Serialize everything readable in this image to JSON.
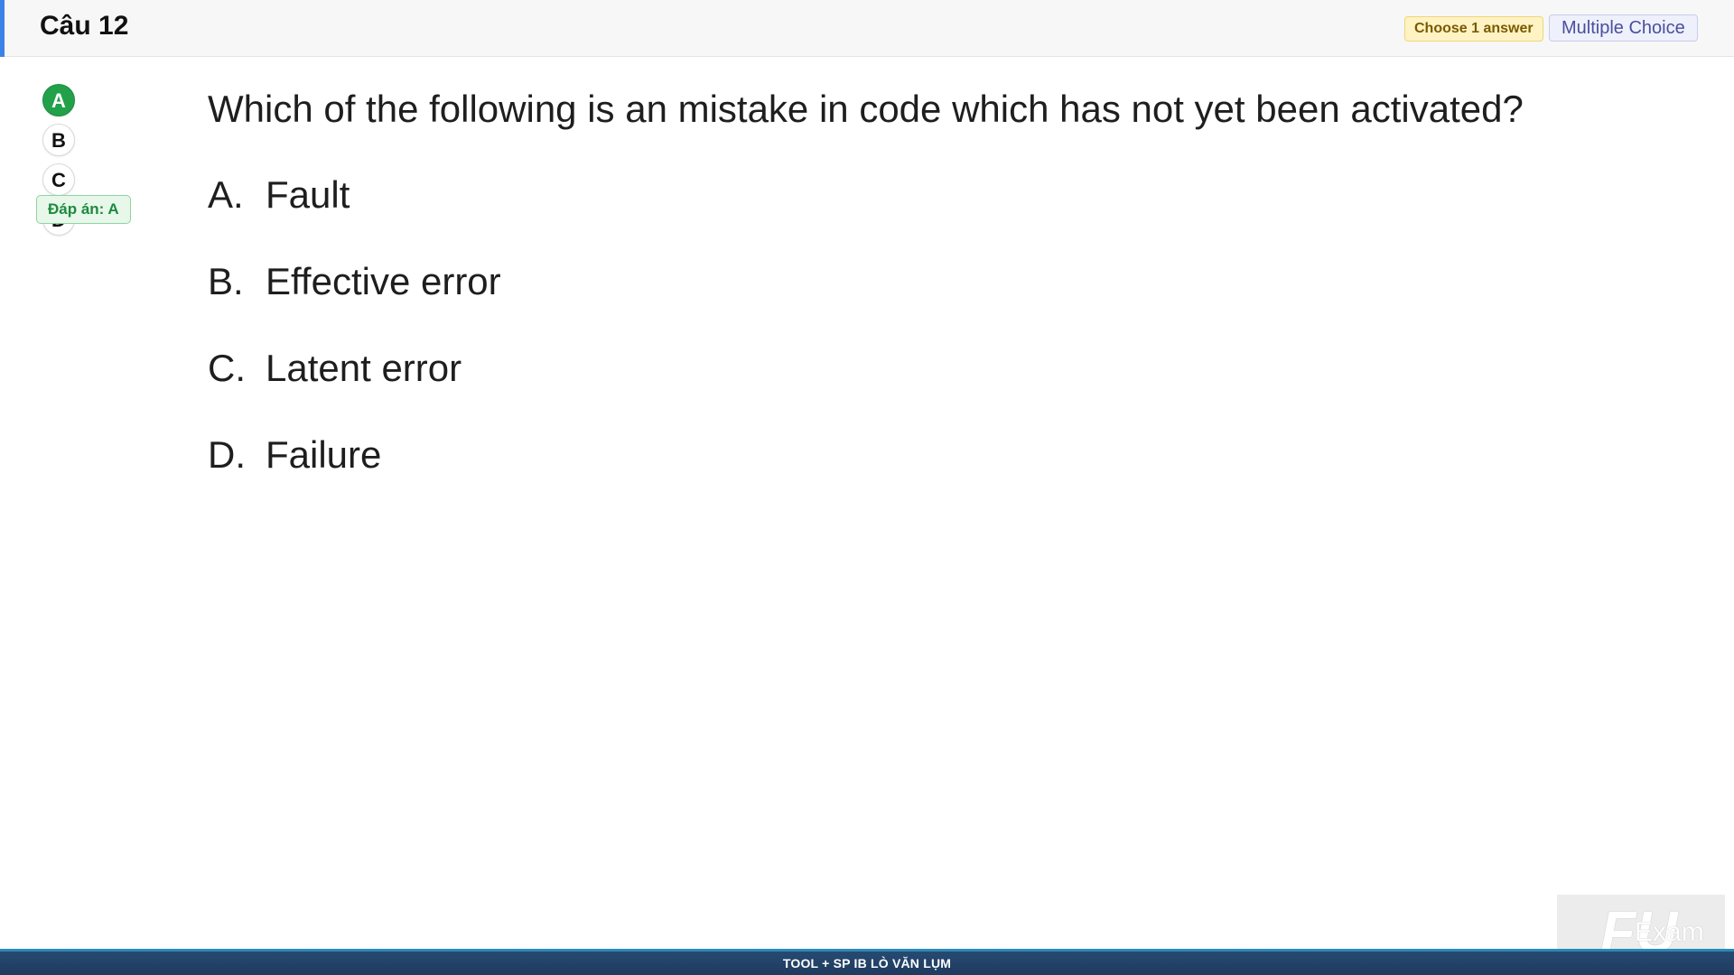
{
  "header": {
    "title": "Câu 12",
    "choose_badge": "Choose 1 answer",
    "type_badge": "Multiple Choice",
    "accent_color": "#3b82e6"
  },
  "option_selector": {
    "options": [
      "A",
      "B",
      "C",
      "D"
    ],
    "selected": "A",
    "selected_color": "#22a14a"
  },
  "answer_key": {
    "label": "Đáp án: A"
  },
  "question": {
    "text": "Which of the following is an mistake in code which has not yet been activated?",
    "answers": [
      {
        "letter": "A.",
        "text": "Fault"
      },
      {
        "letter": "B.",
        "text": "Effective error"
      },
      {
        "letter": "C.",
        "text": "Latent error"
      },
      {
        "letter": "D.",
        "text": "Failure"
      }
    ]
  },
  "watermark": {
    "logo": "FU",
    "text": "Exam"
  },
  "footer": {
    "text": "TOOL + SP IB LÒ VĂN LỤM"
  }
}
